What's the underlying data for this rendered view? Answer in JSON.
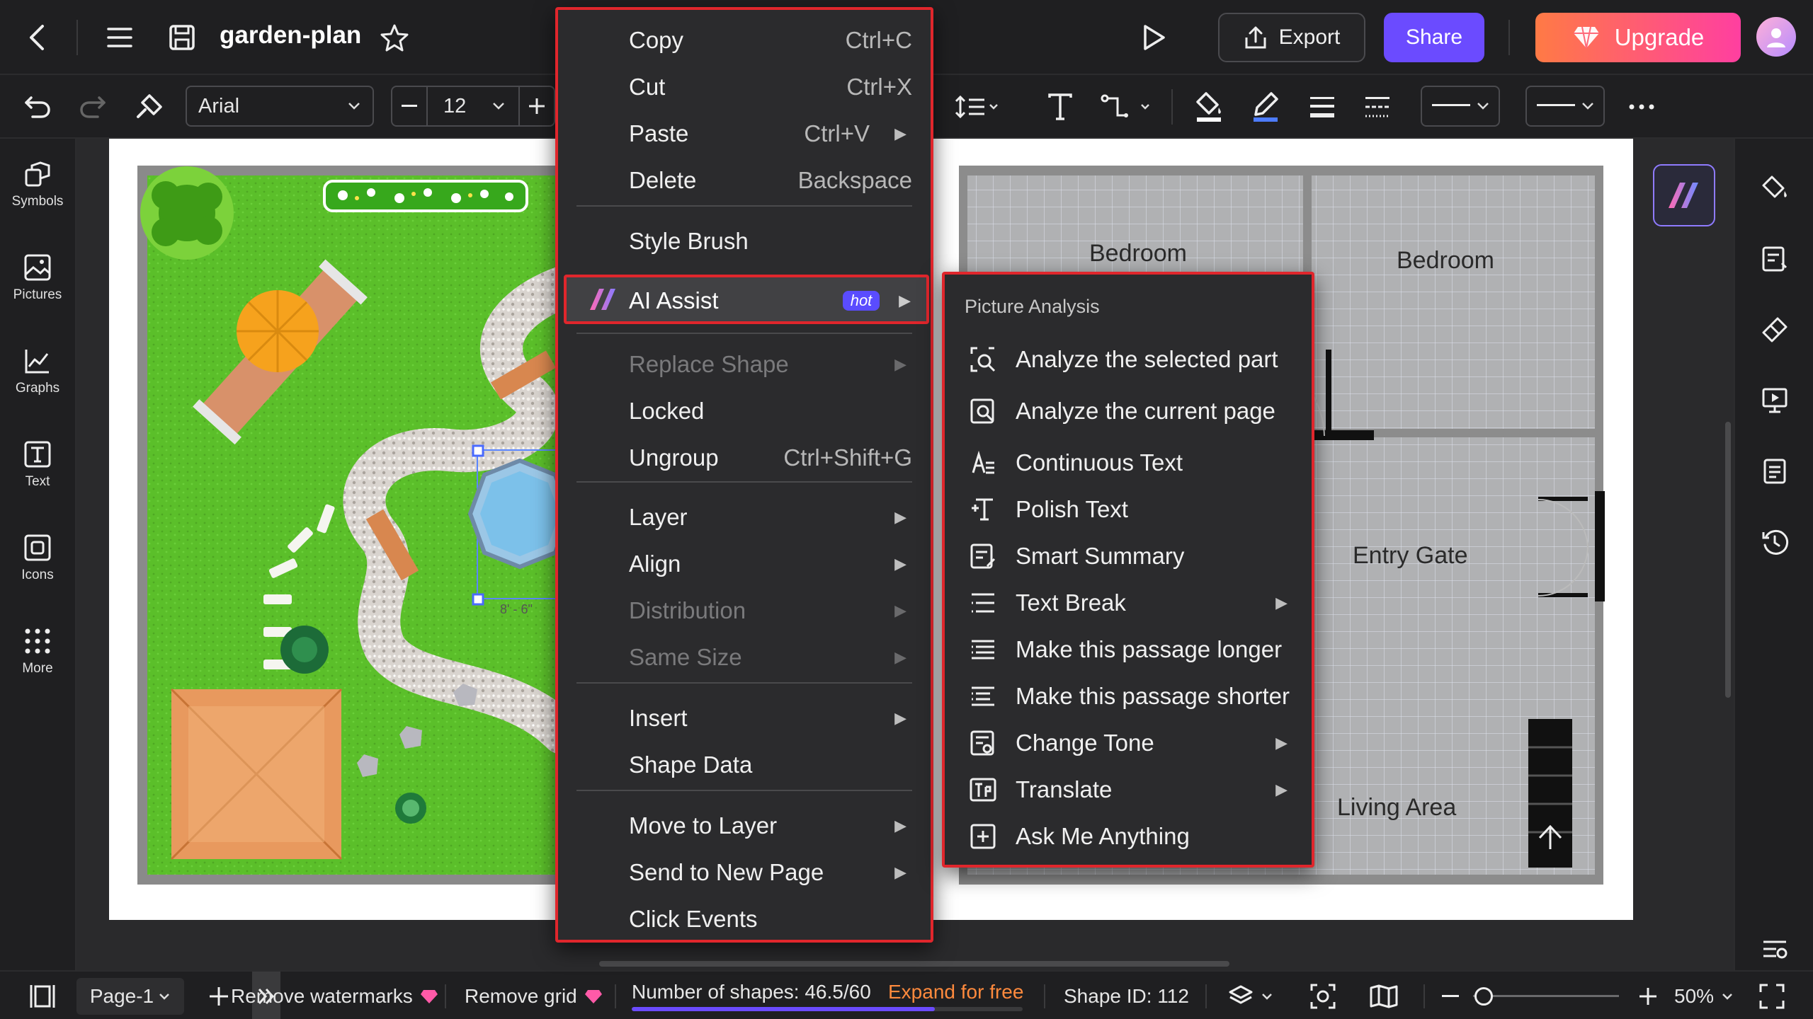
{
  "header": {
    "filename": "garden-plan",
    "export_label": "Export",
    "share_label": "Share",
    "upgrade_label": "Upgrade"
  },
  "toolbar": {
    "font_family": "Arial",
    "font_size": "12"
  },
  "left_panel": {
    "items": [
      {
        "label": "Symbols",
        "icon": "symbols-icon"
      },
      {
        "label": "Pictures",
        "icon": "pictures-icon"
      },
      {
        "label": "Graphs",
        "icon": "graphs-icon"
      },
      {
        "label": "Text",
        "icon": "text-icon"
      },
      {
        "label": "Icons",
        "icon": "icons-icon"
      },
      {
        "label": "More",
        "icon": "more-grid-icon"
      }
    ]
  },
  "canvas": {
    "rooms": [
      "Bedroom",
      "Bedroom",
      "Entry Gate",
      "Living Area"
    ],
    "dimension_text": "8' - 6\""
  },
  "context_menu": {
    "items": [
      {
        "label": "Copy",
        "shortcut": "Ctrl+C"
      },
      {
        "label": "Cut",
        "shortcut": "Ctrl+X"
      },
      {
        "label": "Paste",
        "shortcut": "Ctrl+V"
      },
      {
        "label": "Delete",
        "shortcut": "Backspace"
      },
      {
        "label": "Style Brush"
      },
      {
        "label": "AI Assist",
        "badge": "hot"
      },
      {
        "label": "Replace Shape"
      },
      {
        "label": "Locked"
      },
      {
        "label": "Ungroup",
        "shortcut": "Ctrl+Shift+G"
      },
      {
        "label": "Layer"
      },
      {
        "label": "Align"
      },
      {
        "label": "Distribution"
      },
      {
        "label": "Same Size"
      },
      {
        "label": "Insert"
      },
      {
        "label": "Shape Data"
      },
      {
        "label": "Move to Layer"
      },
      {
        "label": "Send to New Page"
      },
      {
        "label": "Click Events"
      }
    ]
  },
  "ai_submenu": {
    "header": "Picture Analysis",
    "items": [
      {
        "label": "Analyze the selected part",
        "icon": "analyze-selection-icon"
      },
      {
        "label": "Analyze the current page",
        "icon": "analyze-page-icon"
      },
      {
        "label": "Continuous Text",
        "icon": "continuous-text-icon"
      },
      {
        "label": "Polish Text",
        "icon": "polish-text-icon"
      },
      {
        "label": "Smart Summary",
        "icon": "smart-summary-icon"
      },
      {
        "label": "Text Break",
        "icon": "text-break-icon"
      },
      {
        "label": "Make this passage longer",
        "icon": "longer-icon"
      },
      {
        "label": "Make this passage shorter",
        "icon": "shorter-icon"
      },
      {
        "label": "Change Tone",
        "icon": "change-tone-icon"
      },
      {
        "label": "Translate",
        "icon": "translate-icon"
      },
      {
        "label": "Ask Me Anything",
        "icon": "ask-anything-icon"
      }
    ]
  },
  "status_bar": {
    "page_label": "Page-1",
    "remove_watermarks": "Remove watermarks",
    "remove_grid": "Remove grid",
    "shape_count": "Number of shapes: 46.5/60",
    "shape_count_progress": 0.775,
    "expand_label": "Expand for free",
    "shape_id": "Shape ID: 112",
    "zoom": "50%",
    "zoom_level": 0.5
  },
  "colors": {
    "accent_purple": "#6b4bff",
    "highlight_red": "#e0262c",
    "expand_orange": "#ff8a3d",
    "grass_green": "#5bbf2a"
  }
}
